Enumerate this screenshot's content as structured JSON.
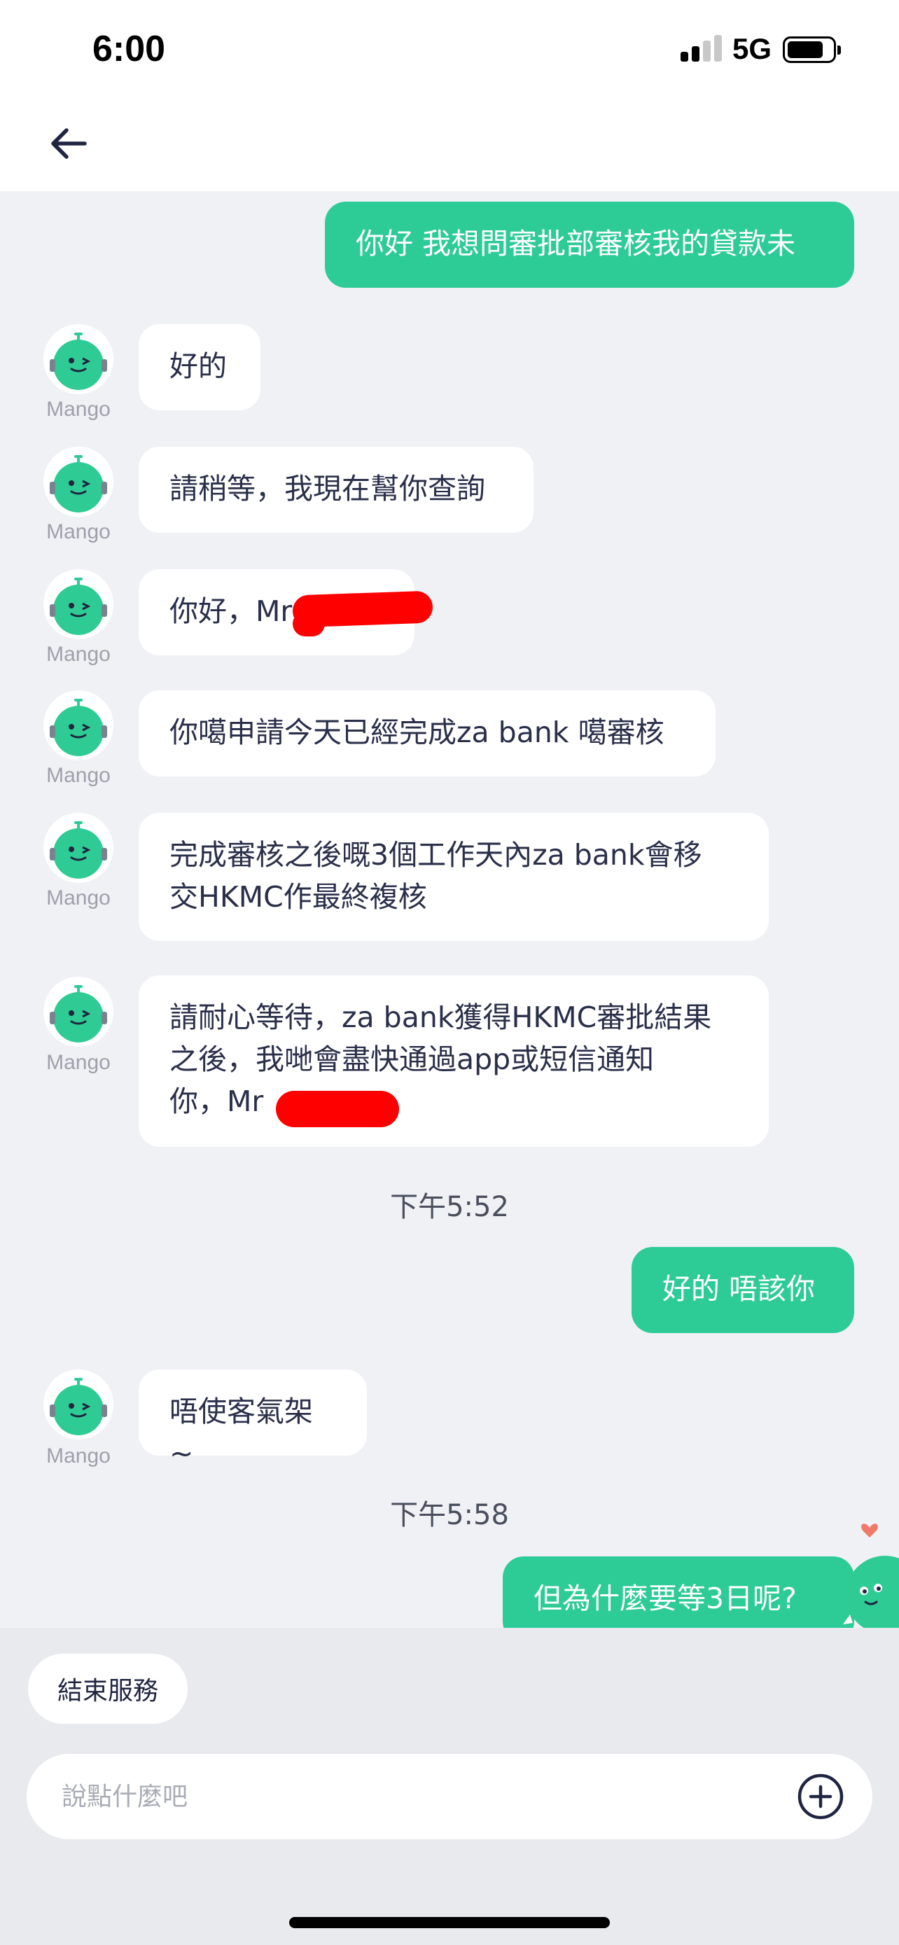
{
  "status_bar": {
    "time": "6:00",
    "network": "5G"
  },
  "agent": {
    "name": "Mango"
  },
  "messages": [
    {
      "side": "out",
      "text": "你好 我想問審批部審核我的貸款未"
    },
    {
      "side": "in",
      "text": "好的"
    },
    {
      "side": "in",
      "text": "請稍等，我現在幫你查詢"
    },
    {
      "side": "in",
      "text": "你好，Mr"
    },
    {
      "side": "in",
      "text": "你噶申請今天已經完成za bank 噶審核"
    },
    {
      "side": "in",
      "text": "完成審核之後嘅3個工作天內za bank會移\n交HKMC作最終複核"
    },
    {
      "side": "in",
      "text": "請耐心等待，za bank獲得HKMC審批結果\n之後，我哋會盡快通過app或短信通知\n你，Mr"
    },
    {
      "side": "out",
      "text": "好的 唔該你"
    },
    {
      "side": "in",
      "text": "唔使客氣架~"
    },
    {
      "side": "out",
      "text": "但為什麼要等3日呢?"
    }
  ],
  "timestamps": [
    "下午5:52",
    "下午5:58"
  ],
  "bottom": {
    "end_service_label": "結束服務",
    "input_placeholder": "說點什麼吧",
    "input_value": ""
  },
  "colors": {
    "accent": "#2dcb96",
    "background": "#f0f1f5",
    "bubble_in": "#ffffff",
    "text_dark": "#2a2f4a"
  },
  "icons": {
    "back": "back-arrow-icon",
    "add": "plus-circle-icon",
    "avatar": "mango-avatar-icon",
    "mascot": "mango-mascot-icon"
  }
}
